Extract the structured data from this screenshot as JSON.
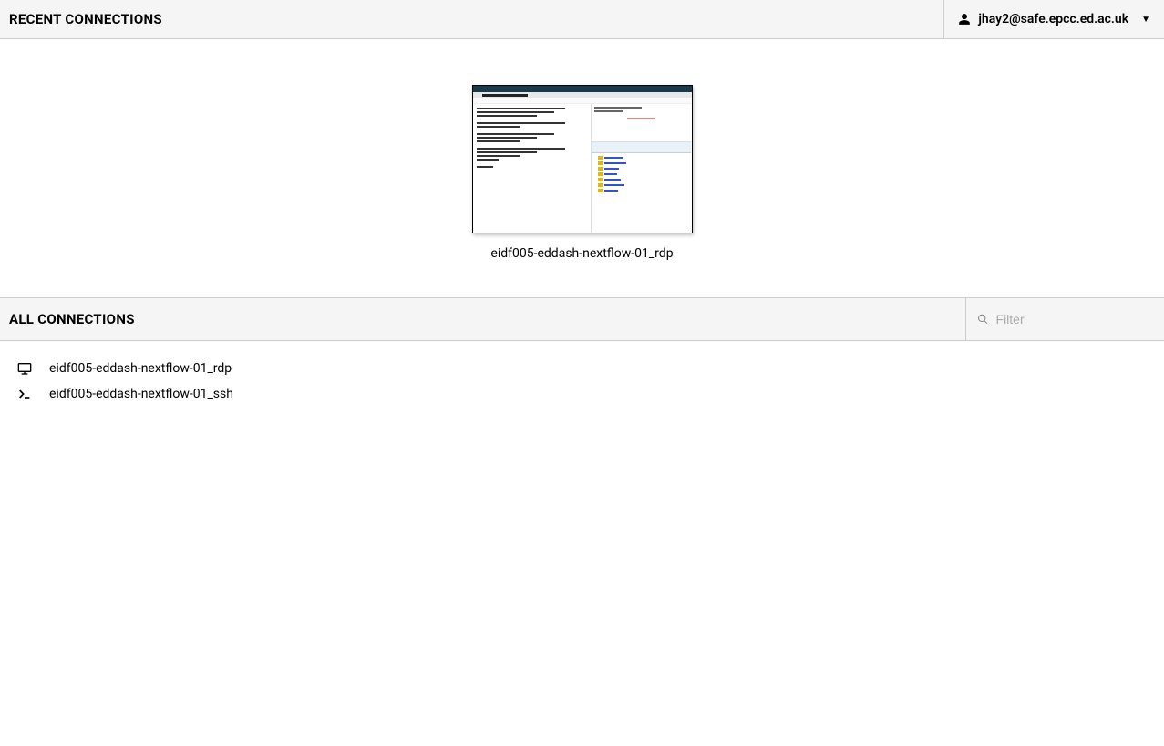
{
  "header": {
    "title": "Recent Connections",
    "user": "jhay2@safe.epcc.ed.ac.uk"
  },
  "recent": {
    "items": [
      {
        "label": "eidf005-eddash-nextflow-01_rdp"
      }
    ]
  },
  "all": {
    "title": "All Connections",
    "filter_placeholder": "Filter",
    "items": [
      {
        "label": "eidf005-eddash-nextflow-01_rdp",
        "icon": "monitor"
      },
      {
        "label": "eidf005-eddash-nextflow-01_ssh",
        "icon": "terminal"
      }
    ]
  }
}
